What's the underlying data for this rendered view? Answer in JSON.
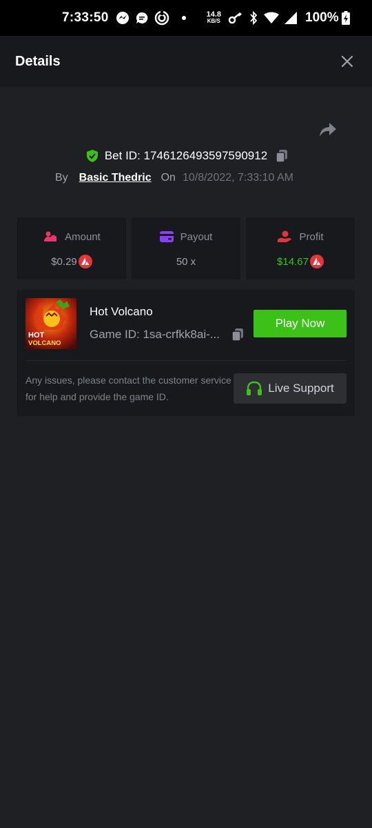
{
  "status_bar": {
    "time": "7:33:50",
    "net_speed_value": "14.8",
    "net_speed_unit": "KB/S",
    "battery": "100%"
  },
  "header": {
    "title": "Details"
  },
  "bet": {
    "bet_id": "Bet ID: 1746126493597590912",
    "by_label": "By",
    "user": "Basic Thedric",
    "on_label": "On",
    "date": "10/8/2022, 7:33:10 AM"
  },
  "stats": [
    {
      "label": "Amount",
      "value": "$0.29",
      "icon": "amount-icon",
      "color": "#e8376d",
      "currency_icon": true
    },
    {
      "label": "Payout",
      "value": "50 x",
      "icon": "payout-card-icon",
      "color": "#8a3ffc",
      "currency_icon": false
    },
    {
      "label": "Profit",
      "value": "$14.67",
      "icon": "profit-hand-icon",
      "color": "#e5343a",
      "currency_icon": true
    }
  ],
  "game": {
    "title": "Hot Volcano",
    "game_id": "Game ID: 1sa-crfkk8ai-...",
    "thumb_text_line1": "HOT",
    "thumb_text_line2": "VOLCANO",
    "play_label": "Play Now",
    "help_text": "Any issues, please contact the customer service for help and provide the game ID.",
    "support_label": "Live Support"
  },
  "colors": {
    "accent_green": "#3bc117",
    "background": "#1f2023",
    "panel": "#18191c",
    "coin_red": "#e5343a"
  }
}
